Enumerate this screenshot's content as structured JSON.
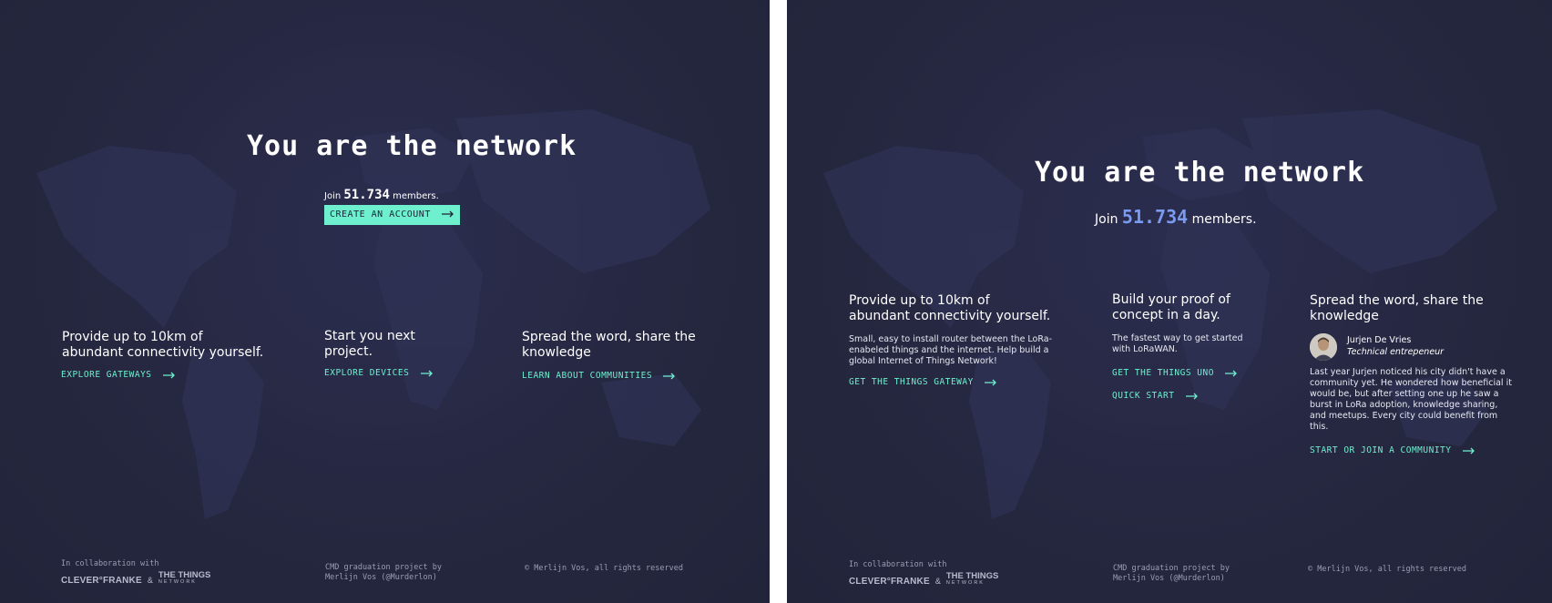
{
  "colors": {
    "background": "#25273f",
    "accent": "#6ef0cf",
    "count_highlight": "#7b9bf0"
  },
  "left": {
    "title": "You are the network",
    "join_prefix": "Join",
    "member_count": "51.734",
    "join_suffix": "members.",
    "cta_label": "CREATE AN ACCOUNT",
    "features": [
      {
        "heading_line1": "Provide up to 10km of",
        "heading_line2": "abundant connectivity yourself.",
        "link": "EXPLORE GATEWAYS"
      },
      {
        "heading_line1": "Start you next",
        "heading_line2": "project.",
        "link": "EXPLORE DEVICES"
      },
      {
        "heading_line1": "Spread the word, share the",
        "heading_line2": "knowledge",
        "link": "LEARN ABOUT COMMUNITIES"
      }
    ],
    "footer": {
      "collab": "In collaboration with",
      "logo1": "CLEVER°FRANKE",
      "amp": "&",
      "logo2_top": "THE THINGS",
      "logo2_bottom": "NETWORK",
      "project_line1": "CMD graduation project by",
      "project_line2": "Merlijn Vos (@Murderlon)",
      "copyright": "© Merlijn Vos, all rights reserved"
    }
  },
  "right": {
    "title": "You are the network",
    "join_prefix": "Join",
    "member_count": "51.734",
    "join_suffix": "members.",
    "col1": {
      "heading_line1": "Provide up to 10km of",
      "heading_line2": "abundant connectivity yourself.",
      "body": [
        "Small, easy to install router between the LoRa-",
        "enabeled things and the internet. Help build a",
        "global Internet of Things Network!"
      ],
      "link": "GET THE THINGS GATEWAY"
    },
    "col2": {
      "heading_line1": "Build your proof of",
      "heading_line2": "concept in a day.",
      "body": [
        "The fastest way to get started",
        "with LoRaWAN."
      ],
      "link1": "GET THE THINGS UNO",
      "link2": "QUICK START"
    },
    "col3": {
      "heading_line1": "Spread the word, share the",
      "heading_line2": "knowledge",
      "person_name": "Jurjen De Vries",
      "person_role": "Technical entrepeneur",
      "body": [
        "Last year Jurjen noticed his city didn't have a",
        "community yet. He wondered how beneficial it",
        "would be, but after setting one up he saw a",
        "burst in LoRa adoption, knowledge sharing,",
        "and meetups. Every city could benefit from",
        "this."
      ],
      "link": "START OR JOIN A COMMUNITY"
    },
    "footer": {
      "collab": "In collaboration with",
      "logo1": "CLEVER°FRANKE",
      "amp": "&",
      "logo2_top": "THE THINGS",
      "logo2_bottom": "NETWORK",
      "project_line1": "CMD graduation project by",
      "project_line2": "Merlijn Vos (@Murderlon)",
      "copyright": "© Merlijn Vos, all rights reserved"
    }
  }
}
